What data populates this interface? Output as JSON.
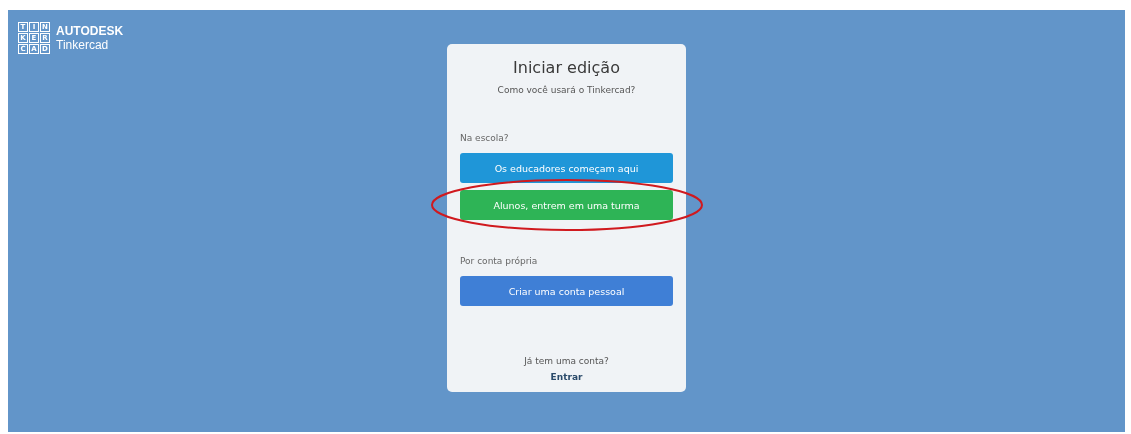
{
  "logo": {
    "tiles": [
      "T",
      "I",
      "N",
      "K",
      "E",
      "R",
      "C",
      "A",
      "D"
    ],
    "brand": "AUTODESK",
    "product": "Tinkercad"
  },
  "card": {
    "title": "Iniciar edição",
    "subtitle": "Como você usará o Tinkercad?",
    "sections": [
      {
        "heading": "Na escola?",
        "buttons": [
          {
            "label": "Os educadores começam aqui",
            "color": "#1f96d8",
            "highlighted": false
          },
          {
            "label": "Alunos, entrem em uma turma",
            "color": "#2eb456",
            "highlighted": true
          }
        ]
      },
      {
        "heading": "Por conta própria",
        "buttons": [
          {
            "label": "Criar uma conta pessoal",
            "color": "#3f7fd6",
            "highlighted": false
          }
        ]
      }
    ],
    "signin_prompt": "Já tem uma conta?",
    "signin_link": "Entrar"
  }
}
